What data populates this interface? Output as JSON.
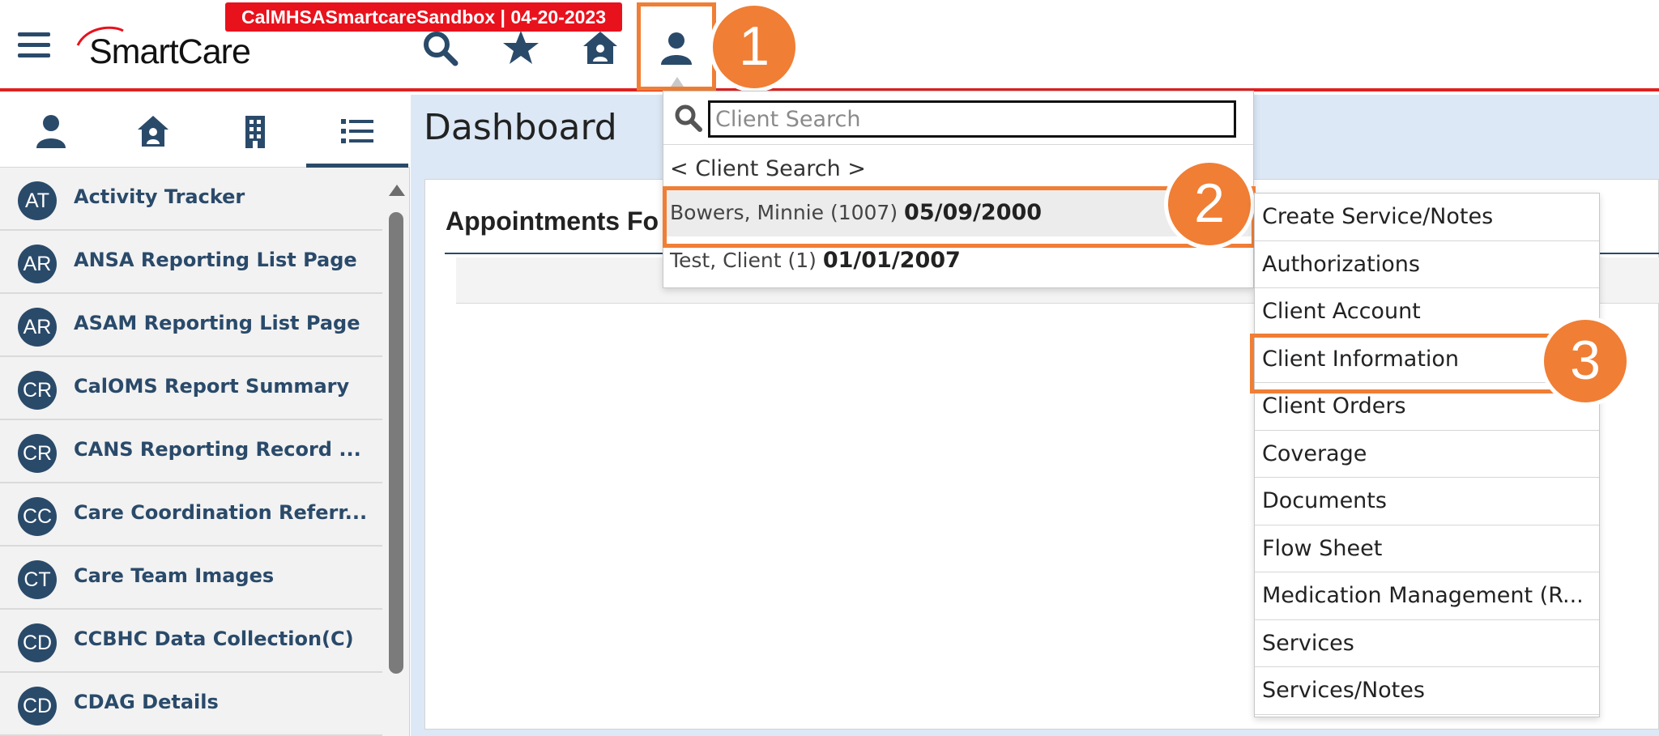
{
  "header": {
    "logo_text": "SmartCare",
    "env_banner": "CalMHSASmartcareSandbox | 04-20-2023",
    "icons": [
      "search-icon",
      "star-icon",
      "home-user-icon",
      "client-icon"
    ]
  },
  "annotations": {
    "step1": "1",
    "step2": "2",
    "step3": "3"
  },
  "sidebar": {
    "tabs": [
      "person-icon",
      "house-icon",
      "building-icon",
      "list-icon"
    ],
    "items": [
      {
        "initials": "AT",
        "label": "Activity Tracker"
      },
      {
        "initials": "AR",
        "label": "ANSA Reporting List Page"
      },
      {
        "initials": "AR",
        "label": "ASAM Reporting List Page"
      },
      {
        "initials": "CR",
        "label": "CalOMS Report Summary"
      },
      {
        "initials": "CR",
        "label": "CANS Reporting Record ..."
      },
      {
        "initials": "CC",
        "label": "Care Coordination Referr..."
      },
      {
        "initials": "CT",
        "label": "Care Team Images"
      },
      {
        "initials": "CD",
        "label": "CCBHC Data Collection(C)"
      },
      {
        "initials": "CD",
        "label": "CDAG Details"
      }
    ]
  },
  "main": {
    "title": "Dashboard",
    "appointments_title": "Appointments Fo"
  },
  "client_search": {
    "placeholder": "Client Search",
    "caption": "< Client Search >",
    "results": [
      {
        "name": "Bowers, Minnie (1007)",
        "dob": "05/09/2000"
      },
      {
        "name": "Test, Client (1)",
        "dob": "01/01/2007"
      }
    ]
  },
  "client_menu": {
    "items": [
      "Create Service/Notes",
      "Authorizations",
      "Client Account",
      "Client Information",
      "Client Orders",
      "Coverage",
      "Documents",
      "Flow Sheet",
      "Medication Management (R...",
      "Services",
      "Services/Notes"
    ]
  },
  "colors": {
    "brand_navy": "#2a4a6a",
    "banner_red": "#e8121d",
    "annotation_orange": "#f07e35",
    "main_bg": "#dce8f5"
  }
}
